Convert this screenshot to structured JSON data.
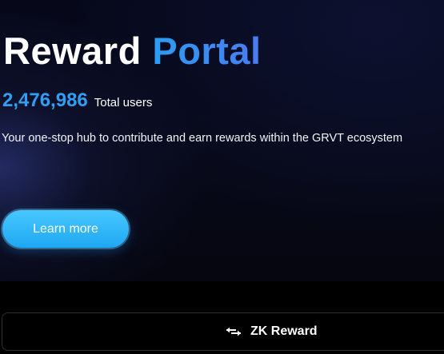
{
  "hero": {
    "title_part1": "Reward",
    "title_part2": "Portal",
    "user_count": "2,476,986",
    "user_count_label": "Total users",
    "description": "Your one-stop hub to contribute and earn rewards within the GRVT ecosystem",
    "cta_label": "Learn more"
  },
  "tabs": {
    "zk_reward": {
      "label": "ZK Reward",
      "icon": "swap-arrows-icon"
    }
  },
  "colors": {
    "accent_blue": "#2f9ff5",
    "button_blue": "#2ab0f5",
    "background": "#000000"
  }
}
